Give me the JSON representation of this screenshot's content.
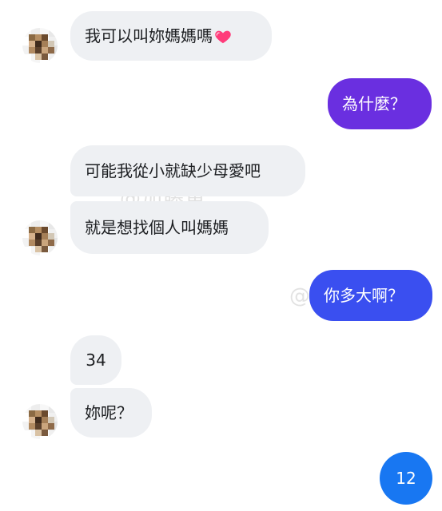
{
  "conversation": {
    "messages": [
      {
        "id": "m1",
        "direction": "incoming",
        "text": "我可以叫妳媽媽嗎",
        "emoji": "pink-heart"
      },
      {
        "id": "m2",
        "direction": "outgoing",
        "text": "為什麼？"
      },
      {
        "id": "m3",
        "direction": "incoming",
        "text": "可能我從小就缺少母愛吧"
      },
      {
        "id": "m4",
        "direction": "incoming",
        "text": "就是想找個人叫媽媽"
      },
      {
        "id": "m5",
        "direction": "outgoing",
        "text": "你多大啊？"
      },
      {
        "id": "m6",
        "direction": "incoming",
        "text": "34"
      },
      {
        "id": "m7",
        "direction": "incoming",
        "text": "妳呢？"
      }
    ],
    "bottom_badge": "12"
  },
  "watermarks": [
    "@加藤軍",
    "@加藤軍"
  ],
  "colors": {
    "incoming_bubble": "#eef0f3",
    "outgoing_purple": "#6a2fe0",
    "outgoing_violet": "#5a37e7",
    "outgoing_blue": "#3a4ff0",
    "badge_blue": "#1877f2",
    "heart": "#ff3b7a"
  },
  "icons": {
    "avatar": "pixelated-avatar",
    "emoji": "heart-icon"
  }
}
